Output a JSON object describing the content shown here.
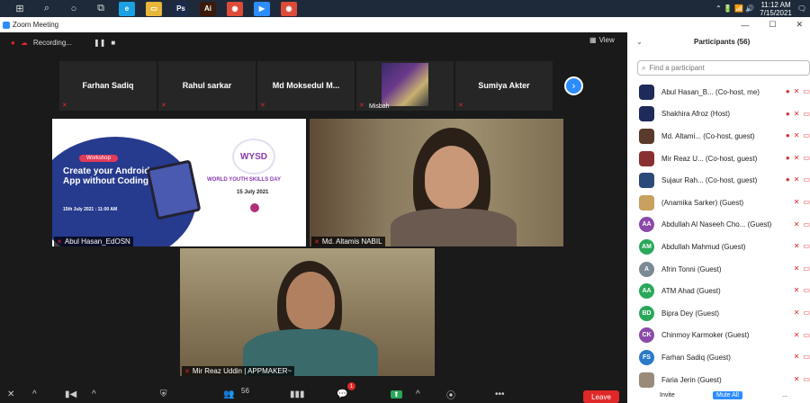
{
  "taskbar": {
    "apps": [
      {
        "name": "windows-start-icon",
        "glyph": "⊞"
      },
      {
        "name": "search-icon",
        "glyph": "⌕"
      },
      {
        "name": "cortana-icon",
        "glyph": "○"
      },
      {
        "name": "task-view-icon",
        "glyph": "⧉"
      },
      {
        "name": "edge-icon",
        "glyph": "e",
        "color": "#1ba1e2"
      },
      {
        "name": "file-explorer-icon",
        "glyph": "▭",
        "color": "#e8b73a"
      },
      {
        "name": "photoshop-icon",
        "glyph": "Ps",
        "color": "#1c2a4a"
      },
      {
        "name": "illustrator-icon",
        "glyph": "Ai",
        "color": "#3a1a0a"
      },
      {
        "name": "chrome-icon",
        "glyph": "◉",
        "color": "#dd4b39"
      },
      {
        "name": "zoom-taskbar-icon",
        "glyph": "▶",
        "color": "#2d8cff"
      },
      {
        "name": "chrome-icon-2",
        "glyph": "◉",
        "color": "#dd4b39"
      }
    ],
    "time": "11:12 AM",
    "date": "7/15/2021"
  },
  "window": {
    "title": "Zoom Meeting"
  },
  "meeting": {
    "recording_label": "Recording...",
    "view_label": "View",
    "strip": [
      {
        "name": "Farhan Sadiq"
      },
      {
        "name": "Rahul sarkar"
      },
      {
        "name": "Md  Moksedul  M..."
      },
      {
        "name": "Misbah",
        "has_video": true
      },
      {
        "name": "Sumiya Akter"
      }
    ],
    "slide": {
      "tag": "Workshop",
      "headline": "Create your Android App without Coding",
      "date": "15th July 2021 : 11:00 AM",
      "logo": "WYSD",
      "event": "WORLD YOUTH SKILLS DAY",
      "event_date": "15 July 2021",
      "caption": "Abul Hasan_EdOSN"
    },
    "cam1_caption": "Md. Altamis NABIL",
    "cam2_caption": "Mir Reaz Uddin | APPMAKER~",
    "participant_count": "56",
    "chat_badge": "1",
    "leave_label": "Leave"
  },
  "panel": {
    "title": "Participants (56)",
    "search_placeholder": "Find a participant",
    "participants": [
      {
        "initials": "",
        "color": "#1e2a5a",
        "name": "Abul Hasan_B... (Co-host, me)"
      },
      {
        "initials": "",
        "color": "#1e2a5a",
        "name": "Shakhira Afroz (Host)"
      },
      {
        "initials": "",
        "color": "#5a3a2a",
        "name": "Md. Altami... (Co-host, guest)"
      },
      {
        "initials": "",
        "color": "#8a3030",
        "name": "Mir Reaz U... (Co-host, guest)"
      },
      {
        "initials": "",
        "color": "#2a4a7a",
        "name": "Sujaur Rah... (Co-host, guest)"
      },
      {
        "initials": "",
        "color": "#c8a060",
        "name": "(Anamika Sarker) (Guest)"
      },
      {
        "initials": "AA",
        "color": "#8a4aa8",
        "name": "Abdullah Al Naseeh Cho... (Guest)"
      },
      {
        "initials": "AM",
        "color": "#2aa85a",
        "name": "Abdullah Mahmud (Guest)"
      },
      {
        "initials": "A",
        "color": "#7a8a94",
        "name": "Afrin Tonni (Guest)"
      },
      {
        "initials": "AA",
        "color": "#2aa85a",
        "name": "ATM Ahad (Guest)"
      },
      {
        "initials": "BD",
        "color": "#2aa85a",
        "name": "Bipra Dey (Guest)"
      },
      {
        "initials": "CK",
        "color": "#8a4aa8",
        "name": "Chinmoy Karmoker (Guest)"
      },
      {
        "initials": "FS",
        "color": "#2a7ac8",
        "name": "Farhan Sadiq (Guest)"
      },
      {
        "initials": "",
        "color": "#9a8a7a",
        "name": "Faria Jerin (Guest)"
      }
    ],
    "invite_label": "Invite",
    "mute_all_label": "Mute All",
    "more_label": "..."
  }
}
